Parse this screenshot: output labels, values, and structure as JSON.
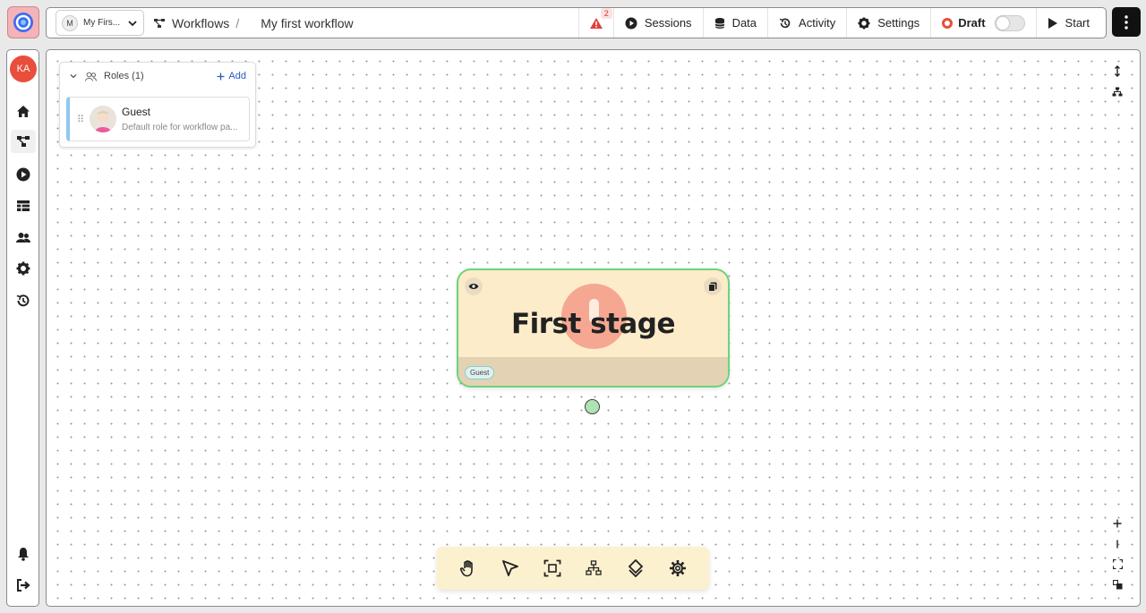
{
  "header": {
    "workspace_initial": "M",
    "workspace_name": "My Firs...",
    "breadcrumb_workflows": "Workflows",
    "breadcrumb_separator": "/",
    "workflow_title": "My first workflow",
    "alert_count": "2",
    "sessions_label": "Sessions",
    "data_label": "Data",
    "activity_label": "Activity",
    "settings_label": "Settings",
    "status_label": "Draft",
    "start_label": "Start"
  },
  "sidebar": {
    "user_initials": "KA",
    "items": [
      "home-icon",
      "workflow-icon",
      "play-icon",
      "table-icon",
      "users-icon",
      "gear-icon",
      "history-icon",
      "bell-icon",
      "logout-icon"
    ]
  },
  "roles": {
    "header_label": "Roles (1)",
    "add_label": "Add",
    "items": [
      {
        "name": "Guest",
        "description": "Default role for workflow pa..."
      }
    ]
  },
  "stage": {
    "title": "First stage",
    "role_tag": "Guest",
    "border_color": "#6cd47b",
    "fill_color": "#fcecca"
  },
  "toolbar": {
    "tools": [
      "hand-icon",
      "pointer-icon",
      "frame-icon",
      "hierarchy-icon",
      "diamond-icon",
      "gear-icon"
    ]
  },
  "colors": {
    "accent_red": "#e94e3c",
    "link_blue": "#2a57c7"
  }
}
